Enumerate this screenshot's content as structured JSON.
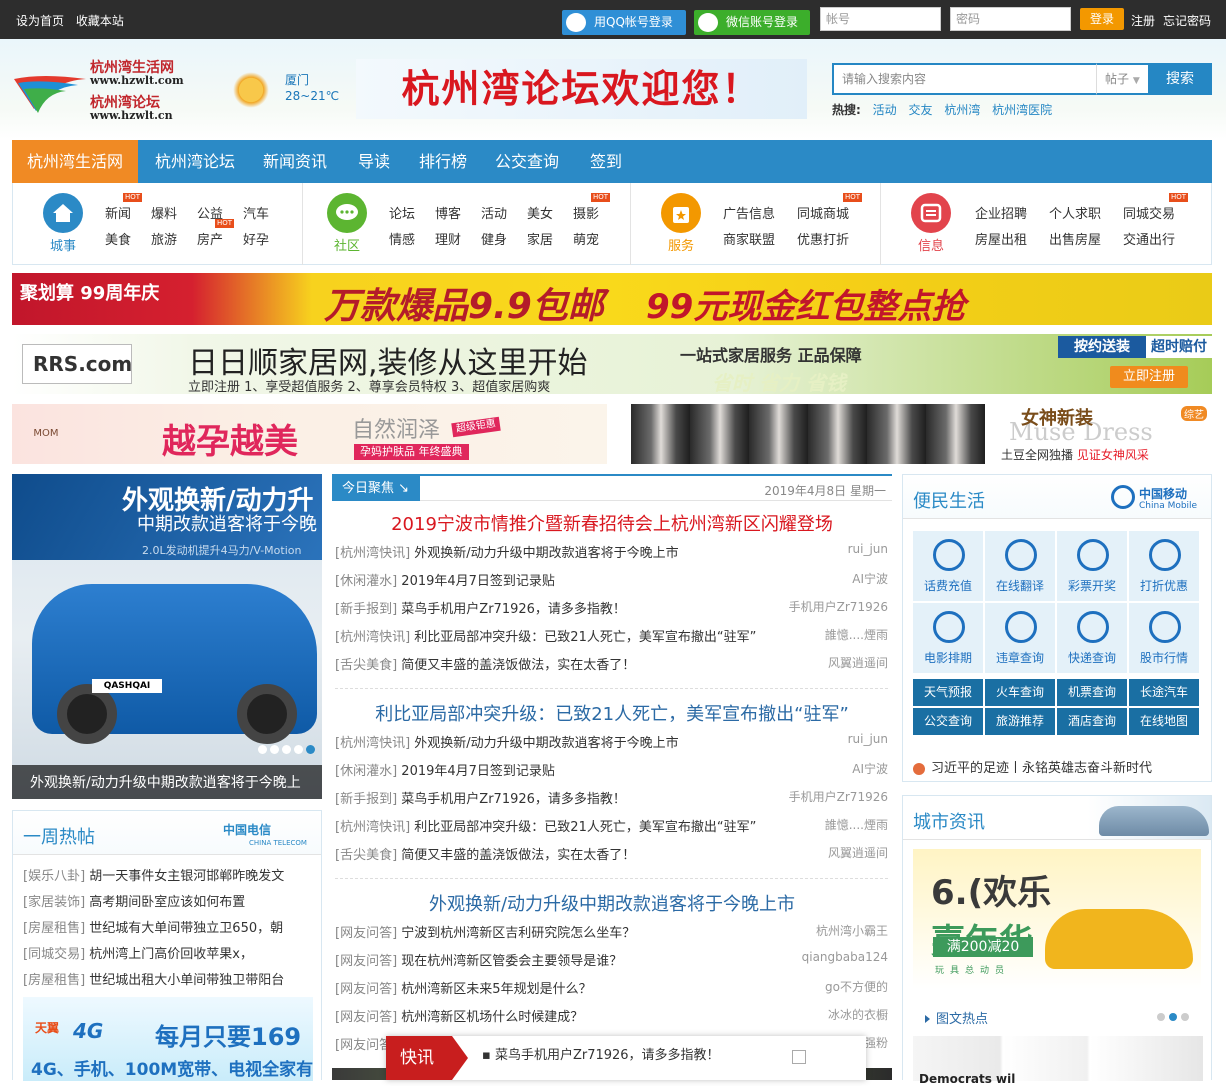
{
  "topbar": {
    "set_home": "设为首页",
    "bookmark": "收藏本站",
    "qq_login": "用QQ帐号登录",
    "wechat_login": "微信账号登录",
    "account_placeholder": "帐号",
    "password_placeholder": "密码",
    "login": "登录",
    "register": "注册",
    "forgot": "忘记密码"
  },
  "header": {
    "logo": {
      "line1": "杭州湾生活网",
      "line2": "www.hzwlt.com",
      "line3": "杭州湾论坛",
      "line4": "www.hzwlt.cn"
    },
    "weather": {
      "city": "厦门",
      "temp": "28~21℃",
      "icon": "partly-cloudy-icon"
    },
    "welcome": "杭州湾论坛欢迎您！",
    "search": {
      "placeholder": "请输入搜索内容",
      "scope": "帖子",
      "button": "搜索",
      "hot_label": "热搜:",
      "hot": [
        "活动",
        "交友",
        "杭州湾",
        "杭州湾医院"
      ]
    }
  },
  "nav": [
    "杭州湾生活网",
    "杭州湾论坛",
    "新闻资讯",
    "导读",
    "排行榜",
    "公交查询",
    "签到"
  ],
  "categories": [
    {
      "title": "城事",
      "icon": "house-icon",
      "color": "#2b8ac6",
      "links": [
        "新闻",
        "爆料",
        "公益",
        "汽车",
        "美食",
        "旅游",
        "房产",
        "好孕"
      ]
    },
    {
      "title": "社区",
      "icon": "chat-icon",
      "color": "#5cb531",
      "links": [
        "论坛",
        "博客",
        "活动",
        "美女",
        "摄影",
        "情感",
        "理财",
        "健身",
        "家居",
        "萌宠"
      ]
    },
    {
      "title": "服务",
      "icon": "bag-icon",
      "color": "#f39800",
      "links": [
        "广告信息",
        "同城商城",
        "商家联盟",
        "优惠打折"
      ]
    },
    {
      "title": "信息",
      "icon": "message-icon",
      "color": "#e2444c",
      "links": [
        "企业招聘",
        "个人求职",
        "同城交易",
        "房屋出租",
        "出售房屋",
        "交通出行"
      ]
    }
  ],
  "hot_badge": "HOT",
  "banners": {
    "b1": {
      "a": "聚划算 99周年庆",
      "b": "万款爆品9.9包邮",
      "c": "99元现金红包整点抢"
    },
    "b2": {
      "logo": "RRS.com",
      "t1": "日日顺家居网,装修从这里开始",
      "t2": "立即注册  1、享受超值服务   2、尊享会员特权   3、超值家居购爽",
      "t3": "一站式家居服务 正品保障",
      "t4": "省时 省力 省钱",
      "t5": "按约送装",
      "t6": "超时赔付",
      "t7": "立即注册"
    },
    "b3": {
      "brand": "MOM FACE",
      "t1": "越孕越美",
      "t2": "自然润泽",
      "t3": "孕妈护肤品 年终盛典",
      "t4": "超级钜惠"
    },
    "b4": {
      "t1": "Muse  Dress",
      "t2": "女神新装",
      "t3a": "土豆全网独播 ",
      "t3b": "见证女神风采",
      "t4": "综艺"
    }
  },
  "slider": {
    "title1": "外观换新/动力升",
    "title2": "中期改款逍客将于今晚",
    "title3": "2.0L发动机提升4马力/V-Motion",
    "plate": "QASHQAI",
    "caption": "外观换新/动力升级中期改款逍客将于今晚上",
    "dots": 5,
    "active_dot": 5
  },
  "weekly": {
    "title": "一周热帖",
    "sponsor": "中国电信",
    "sponsor_en": "CHINA TELECOM",
    "rows": [
      {
        "cat": "[娱乐八卦]",
        "text": "胡一天事件女主银河邯郸昨晚发文"
      },
      {
        "cat": "[家居装饰]",
        "text": "高考期间卧室应该如何布置"
      },
      {
        "cat": "[房屋租售]",
        "text": "世纪城有大单间带独立卫650，朝"
      },
      {
        "cat": "[同城交易]",
        "text": "杭州湾上门高价回收苹果x，"
      },
      {
        "cat": "[房屋租售]",
        "text": "世纪城出租大小单间带独卫带阳台"
      }
    ],
    "ad": {
      "a1": "天翼",
      "a2": "4G",
      "a3": "每月只要169",
      "a4": "4G、手机、100M宽带、电视全家有"
    }
  },
  "news": {
    "tab": "今日聚焦",
    "date": "2019年4月8日  星期一",
    "groups": [
      {
        "headline": "2019宁波市情推介暨新春招待会上杭州湾新区闪耀登场",
        "headline_color": "#d9171f",
        "rows": [
          {
            "cat": "[杭州湾快讯]",
            "text": "外观换新/动力升级中期改款逍客将于今晚上市",
            "user": "rui_jun"
          },
          {
            "cat": "[休闲灌水]",
            "text": "2019年4月7日签到记录贴",
            "user": "AI宁波"
          },
          {
            "cat": "[新手报到]",
            "text": "菜鸟手机用户Zr71926，请多多指教！",
            "user": "手机用户Zr71926"
          },
          {
            "cat": "[杭州湾快讯]",
            "text": "利比亚局部冲突升级：已致21人死亡，美军宣布撤出“驻军”",
            "user": "誰憶....煙雨"
          },
          {
            "cat": "[舌尖美食]",
            "text": "简便又丰盛的盖浇饭做法，实在太香了！",
            "user": "风翼逍遥间"
          }
        ]
      },
      {
        "headline": "利比亚局部冲突升级：已致21人死亡，美军宣布撤出“驻军”",
        "headline_color": "#2b6aa5",
        "rows": [
          {
            "cat": "[杭州湾快讯]",
            "text": "外观换新/动力升级中期改款逍客将于今晚上市",
            "user": "rui_jun"
          },
          {
            "cat": "[休闲灌水]",
            "text": "2019年4月7日签到记录贴",
            "user": "AI宁波"
          },
          {
            "cat": "[新手报到]",
            "text": "菜鸟手机用户Zr71926，请多多指教！",
            "user": "手机用户Zr71926"
          },
          {
            "cat": "[杭州湾快讯]",
            "text": "利比亚局部冲突升级：已致21人死亡，美军宣布撤出“驻军”",
            "user": "誰憶....煙雨"
          },
          {
            "cat": "[舌尖美食]",
            "text": "简便又丰盛的盖浇饭做法，实在太香了！",
            "user": "风翼逍遥间"
          }
        ]
      },
      {
        "headline": "外观换新/动力升级中期改款逍客将于今晚上市",
        "headline_color": "#2b6aa5",
        "rows": [
          {
            "cat": "[网友问答]",
            "text": "宁波到杭州湾新区吉利研究院怎么坐车？",
            "user": "杭州湾小霸王"
          },
          {
            "cat": "[网友问答]",
            "text": "现在杭州湾新区管委会主要领导是谁？",
            "user": "qiangbaba124"
          },
          {
            "cat": "[网友问答]",
            "text": "杭州湾新区未来5年规划是什么？",
            "user": "go不方便的"
          },
          {
            "cat": "[网友问答]",
            "text": "杭州湾新区机场什么时候建成？",
            "user": "冰冰的衣橱"
          },
          {
            "cat": "[网友问答]",
            "text": "",
            "user": "超级富强粉"
          }
        ]
      }
    ]
  },
  "flash": {
    "label": "快讯",
    "text": "菜鸟手机用户Zr71926，请多多指教！"
  },
  "life": {
    "title": "便民生活",
    "sponsor": "中国移动",
    "sponsor_en": "China Mobile",
    "tiles": [
      {
        "label": "话费充值",
        "icon": "phone-icon"
      },
      {
        "label": "在线翻译",
        "icon": "translate-icon"
      },
      {
        "label": "彩票开奖",
        "icon": "people-icon"
      },
      {
        "label": "打折优惠",
        "icon": "sold-bag-icon"
      },
      {
        "label": "电影排期",
        "icon": "film-icon"
      },
      {
        "label": "违章查询",
        "icon": "no-parking-icon"
      },
      {
        "label": "快递查询",
        "icon": "mail-icon"
      },
      {
        "label": "股市行情",
        "icon": "chart-icon"
      }
    ],
    "buttons": [
      "天气预报",
      "火车查询",
      "机票查询",
      "长途汽车",
      "公交查询",
      "旅游推荐",
      "酒店查询",
      "在线地图"
    ],
    "footer": "习近平的足迹丨永铭英雄志奋斗新时代"
  },
  "city": {
    "title": "城市资讯",
    "pic": {
      "p1": "6.(欢乐",
      "p1b": "嘉年华",
      "p2": "满200减20",
      "p3": "玩具总动员"
    },
    "tag": "图文热点",
    "thumb_text": "Democrats wil",
    "dots": 3,
    "active_dot": 2
  }
}
